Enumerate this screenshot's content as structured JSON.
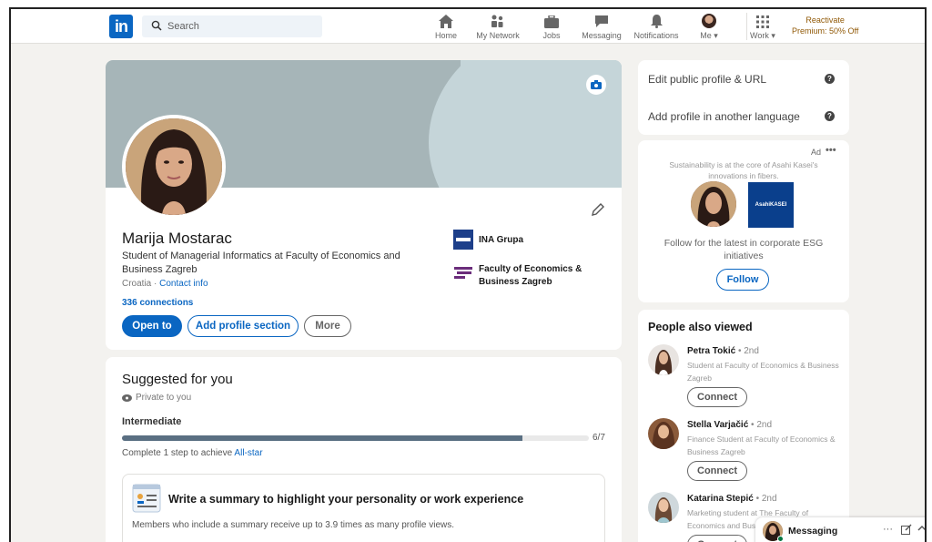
{
  "nav": {
    "search_placeholder": "Search",
    "items": [
      {
        "label": "Home",
        "icon": "home-icon"
      },
      {
        "label": "My Network",
        "icon": "network-icon"
      },
      {
        "label": "Jobs",
        "icon": "briefcase-icon"
      },
      {
        "label": "Messaging",
        "icon": "message-icon"
      },
      {
        "label": "Notifications",
        "icon": "bell-icon"
      },
      {
        "label": "Me",
        "icon": "avatar"
      },
      {
        "label": "Work",
        "icon": "grid-icon"
      }
    ],
    "premium_line1": "Reactivate",
    "premium_line2": "Premium: 50% Off"
  },
  "profile": {
    "name": "Marija Mostarac",
    "headline": "Student of Managerial Informatics at Faculty of Economics and Business Zagreb",
    "location": "Croatia",
    "separator": " · ",
    "contact_info": "Contact info",
    "connections": "336 connections",
    "buttons": {
      "open_to": "Open to",
      "add_section": "Add profile section",
      "more": "More"
    },
    "orgs": [
      {
        "name": "INA Grupa"
      },
      {
        "name": "Faculty of Economics & Business Zagreb"
      }
    ]
  },
  "suggested": {
    "title": "Suggested for you",
    "private": "Private to you",
    "level": "Intermediate",
    "progress_value": 6,
    "progress_max": 7,
    "progress_label": "6/7",
    "step_text": "Complete 1 step to achieve ",
    "step_link": "All-star",
    "card_title": "Write a summary to highlight your personality or work experience",
    "card_desc": "Members who include a summary receive up to 3.9 times as many profile views."
  },
  "right": {
    "edit_url": "Edit public profile & URL",
    "add_language": "Add profile in another language",
    "ad": {
      "label": "Ad",
      "dots": "•••",
      "text": "Sustainability is at the core of Asahi Kasei's innovations in fibers.",
      "logo_text": "AsahiKASEI",
      "follow_text": "Follow for the latest in corporate ESG initiatives",
      "follow_button": "Follow"
    },
    "people_title": "People also viewed",
    "people": [
      {
        "name": "Petra Tokić",
        "degree": " • 2nd",
        "desc": "Student at Faculty of Economics & Business Zagreb",
        "button": "Connect"
      },
      {
        "name": "Stella Varjačić",
        "degree": " • 2nd",
        "desc": "Finance Student at Faculty of Economics & Business Zagreb",
        "button": "Connect"
      },
      {
        "name": "Katarina Stepić",
        "degree": " • 2nd",
        "desc": "Marketing student at The Faculty of Economics and Busi",
        "button": "Connect"
      }
    ]
  },
  "messaging": {
    "label": "Messaging",
    "dots": "···"
  },
  "colors": {
    "brand": "#0a66c2",
    "premium": "#915907",
    "background": "#f3f2ef"
  }
}
